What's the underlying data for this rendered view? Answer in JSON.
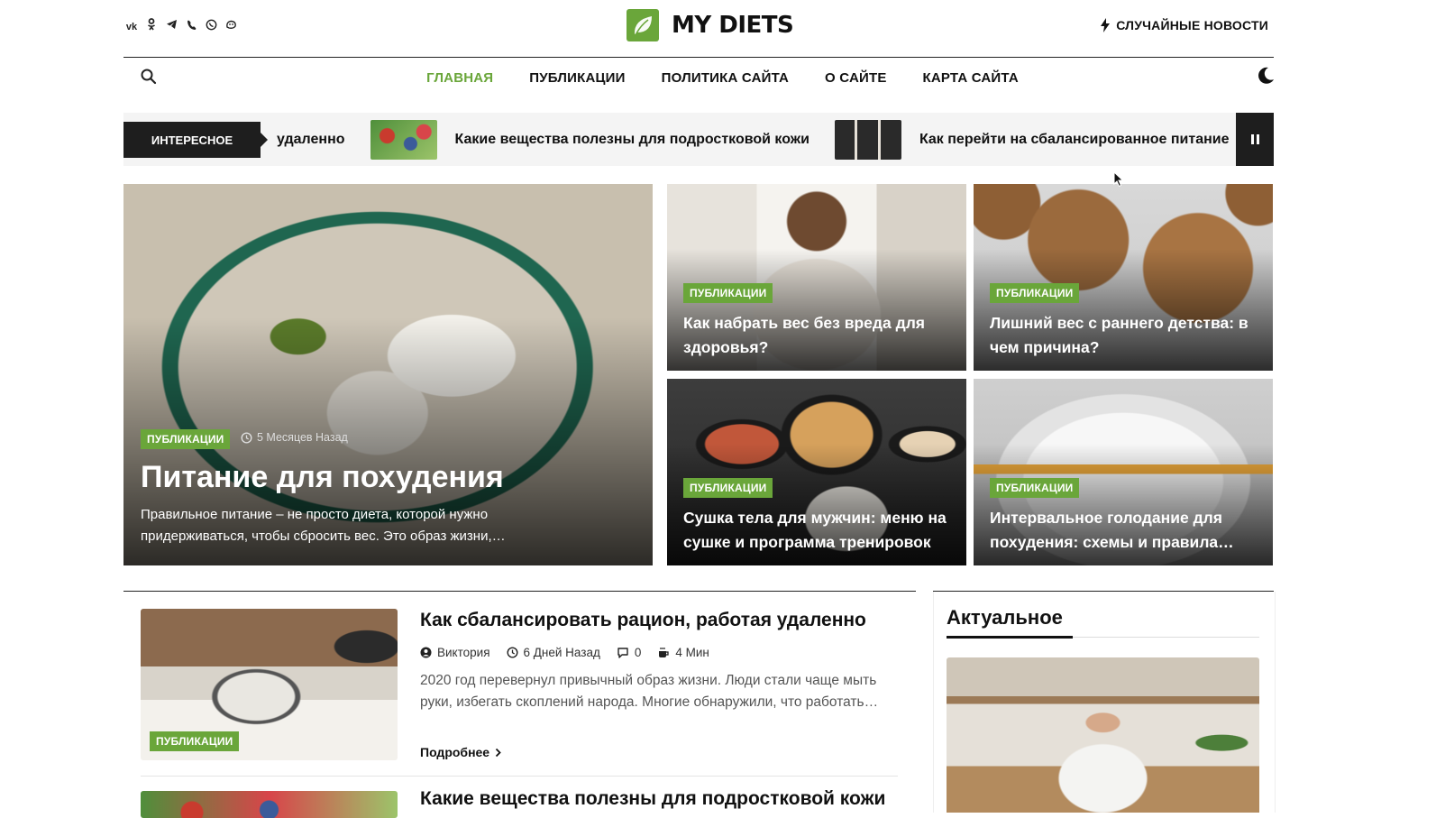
{
  "header": {
    "socials": [
      {
        "icon": "vk-icon",
        "glyph": "vk"
      },
      {
        "icon": "odnoklassniki-icon",
        "glyph": "ok"
      },
      {
        "icon": "telegram-icon",
        "glyph": "tg"
      },
      {
        "icon": "viber-icon",
        "glyph": "vb"
      },
      {
        "icon": "whatsapp-icon",
        "glyph": "wa"
      },
      {
        "icon": "max-icon",
        "glyph": "mx"
      }
    ],
    "logo_text": "MY DIETS",
    "random_news": "СЛУЧАЙНЫЕ НОВОСТИ"
  },
  "nav": {
    "items": [
      "ГЛАВНАЯ",
      "ПУБЛИКАЦИИ",
      "ПОЛИТИКА САЙТА",
      "О САЙТЕ",
      "КАРТА САЙТА"
    ],
    "active_index": 0
  },
  "ticker": {
    "label": "ИНТЕРЕСНОЕ",
    "items": [
      "удаленно",
      "Какие вещества полезны для подростковой кожи",
      "Как перейти на сбалансированное питание"
    ]
  },
  "hero": {
    "main": {
      "category": "ПУБЛИКАЦИИ",
      "time": "5 Месяцев Назад",
      "title": "Питание для похудения",
      "excerpt": "Правильное питание – не просто диета, которой нужно придерживаться, чтобы сбросить вес. Это образ жизни,…"
    },
    "cards": [
      {
        "category": "ПУБЛИКАЦИИ",
        "title": "Как набрать вес без вреда для здоровья?"
      },
      {
        "category": "ПУБЛИКАЦИИ",
        "title": "Лишний вес с раннего детства: в чем причина?"
      },
      {
        "category": "ПУБЛИКАЦИИ",
        "title": "Сушка тела для мужчин: меню на сушке и программа тренировок"
      },
      {
        "category": "ПУБЛИКАЦИИ",
        "title": "Интервальное голодание для похудения: схемы и правила…"
      }
    ]
  },
  "post": {
    "category": "ПУБЛИКАЦИИ",
    "title": "Как сбалансировать рацион, работая удаленно",
    "author": "Виктория",
    "time": "6 Дней Назад",
    "comments": "0",
    "read_time": "4 Мин",
    "excerpt": "2020 год перевернул привычный образ жизни. Люди стали чаще мыть руки, избегать скоплений народа. Многие обнаружили, что работать…",
    "more": "Подробнее"
  },
  "next_post": {
    "title": "Какие вещества полезны для подростковой кожи"
  },
  "sidebar": {
    "title": "Актуальное"
  },
  "colors": {
    "accent": "#6aa63a",
    "dark": "#1e1e1e"
  }
}
